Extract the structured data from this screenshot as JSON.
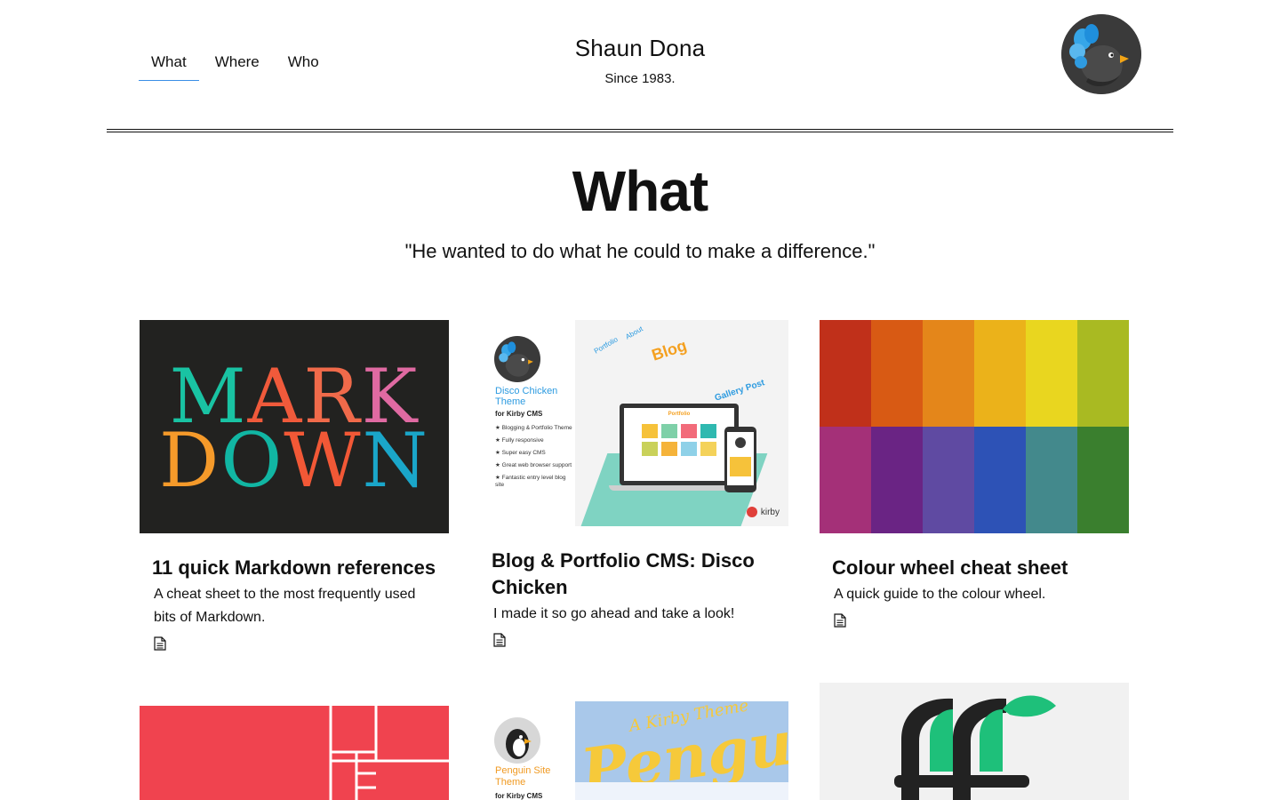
{
  "header": {
    "nav": [
      {
        "label": "What",
        "active": true
      },
      {
        "label": "Where",
        "active": false
      },
      {
        "label": "Who",
        "active": false
      }
    ],
    "site_name": "Shaun Dona",
    "tagline": "Since 1983.",
    "logo_icon": "bird-logo-icon"
  },
  "hero": {
    "title": "What",
    "quote": "\"He wanted to do what he could to make a difference.\""
  },
  "cards": [
    {
      "title": "11 quick Markdown references",
      "desc": "A cheat sheet to the most frequently used bits of Markdown.",
      "thumb": {
        "line1": [
          "M",
          "A",
          "R",
          "K"
        ],
        "line2": [
          "D",
          "O",
          "W",
          "N"
        ]
      }
    },
    {
      "title": "Blog & Portfolio CMS: Disco Chicken",
      "desc": "I made it so go ahead and take a look!",
      "thumb": {
        "theme_name": "Disco Chicken Theme",
        "for": "for Kirby CMS",
        "features": [
          "Blogging & Portfolio Theme",
          "Fully responsive",
          "Super easy CMS",
          "Great web browser support",
          "Fantastic entry level blog site"
        ],
        "words": [
          "Blog",
          "Gallery Post",
          "Portfolio",
          "About"
        ],
        "screen_title": "Portfolio",
        "brand": "kirby"
      }
    },
    {
      "title": "Colour wheel cheat sheet",
      "desc": "A quick guide to the colour wheel.",
      "thumb": {
        "colors": [
          "#c0301a",
          "#d85a14",
          "#e4861a",
          "#ebb21a",
          "#e9d61f",
          "#a9ba22",
          "#a43078",
          "#6a2484",
          "#5f4aa2",
          "#2d52b6",
          "#43898c",
          "#3a7f2e"
        ]
      }
    },
    {
      "title": "",
      "desc": "",
      "thumb": {
        "color": "#f0434f"
      }
    },
    {
      "title": "",
      "desc": "",
      "thumb": {
        "theme_name": "Penguin Site Theme",
        "for": "for Kirby CMS",
        "banner": "Penguin",
        "banner_small": "A Kirby Theme"
      }
    },
    {
      "title": "",
      "desc": "",
      "thumb": {
        "icon": "ff-ligature-icon"
      }
    }
  ],
  "colors": {
    "accent": "#3a8ee6",
    "text": "#111111",
    "markdown_letters": [
      "#19c3a3",
      "#f05a3b",
      "#f06a4a",
      "#e06aa2",
      "#f59a2a",
      "#11b6a3",
      "#f25836",
      "#1aa6c9"
    ]
  }
}
